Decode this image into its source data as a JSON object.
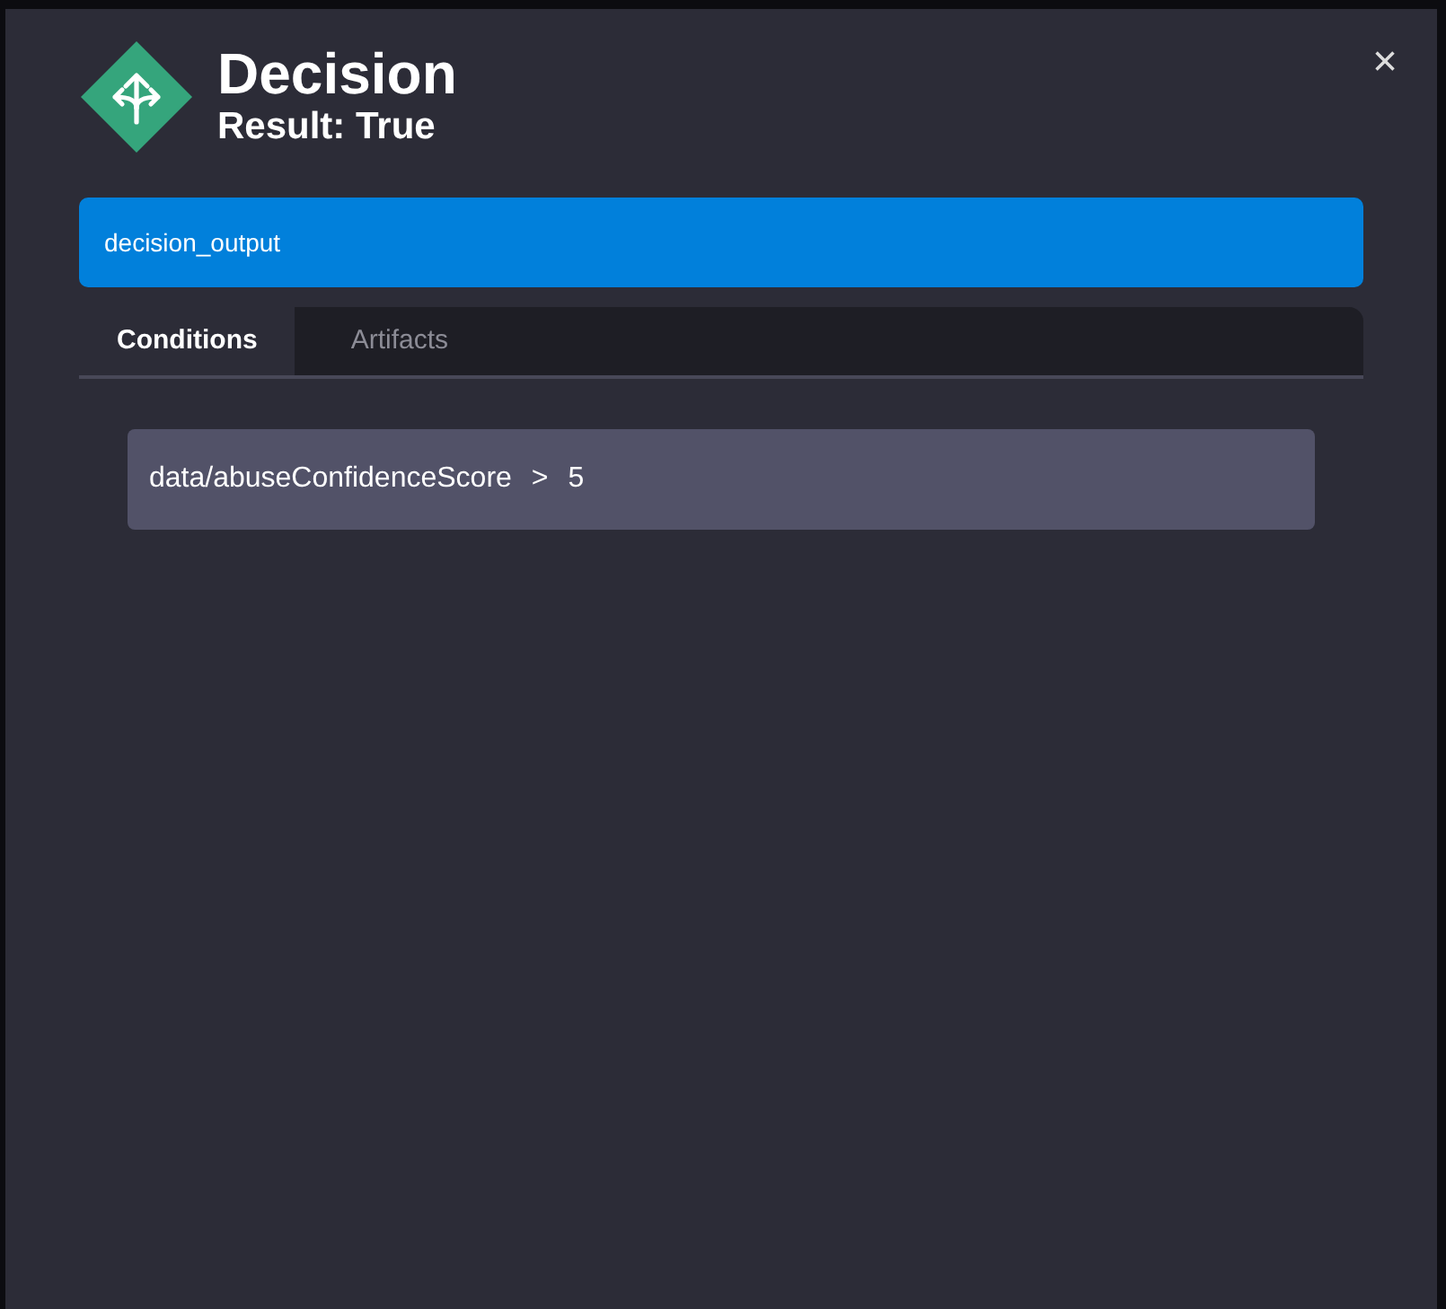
{
  "dialog": {
    "title": "Decision",
    "subtitle": "Result: True",
    "close": "×"
  },
  "output_bar": {
    "label": "decision_output"
  },
  "tabs": [
    {
      "label": "Conditions",
      "selected": true
    },
    {
      "label": "Artifacts",
      "selected": false
    }
  ],
  "conditions": [
    {
      "field": "data/abuseConfidenceScore",
      "operator": ">",
      "value": "5"
    }
  ]
}
